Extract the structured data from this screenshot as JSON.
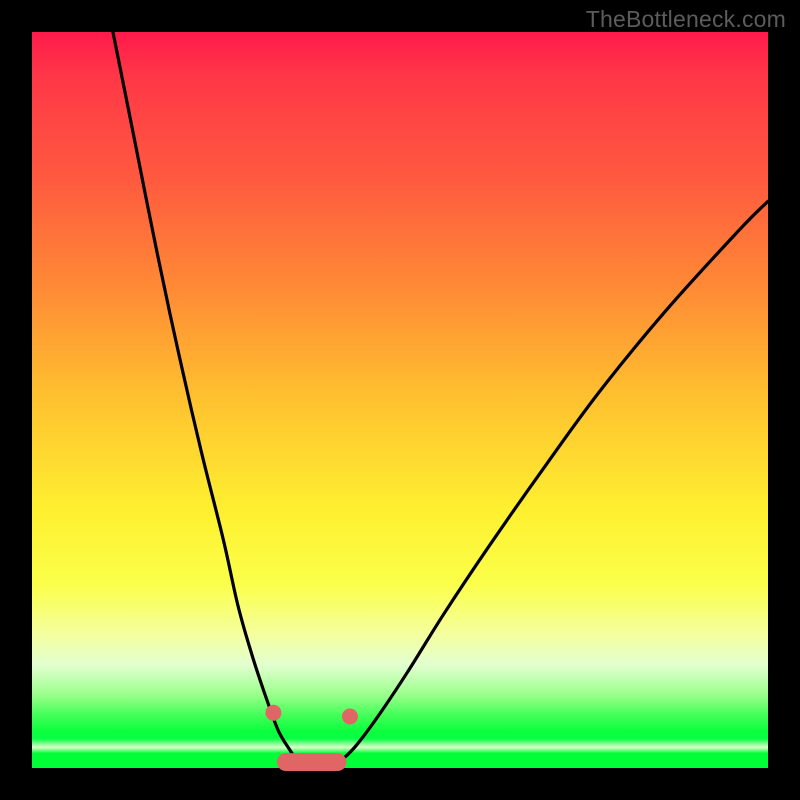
{
  "watermark": "TheBottleneck.com",
  "colors": {
    "frame": "#000000",
    "curve": "#000000",
    "marker_stroke": "#e06666",
    "marker_fill": "#e06666"
  },
  "chart_data": {
    "type": "line",
    "title": "",
    "xlabel": "",
    "ylabel": "",
    "xlim": [
      0,
      100
    ],
    "ylim": [
      0,
      100
    ],
    "grid": false,
    "legend": false,
    "description": "Bottleneck-style V-curve: two black curves descending from top, meeting near bottom at a flat minimum; pink rounded segment and two pink dots mark the minimum region.",
    "series": [
      {
        "name": "left-branch",
        "x": [
          11,
          14,
          17,
          20,
          23,
          26,
          28,
          30,
          32,
          33.5,
          35,
          36
        ],
        "y": [
          100,
          85,
          70,
          56,
          43,
          31,
          22,
          15,
          9,
          5,
          2.5,
          1
        ]
      },
      {
        "name": "right-branch",
        "x": [
          42,
          44,
          47,
          51,
          56,
          62,
          69,
          77,
          86,
          96,
          100
        ],
        "y": [
          1,
          3,
          7,
          13,
          21,
          30,
          40,
          51,
          62,
          73,
          77
        ]
      },
      {
        "name": "floor-segment",
        "x": [
          34.5,
          41.5
        ],
        "y": [
          0.8,
          0.8
        ]
      }
    ],
    "markers": [
      {
        "name": "left-dot",
        "x": 32.8,
        "y": 7.5
      },
      {
        "name": "right-dot",
        "x": 43.2,
        "y": 7.0
      }
    ]
  }
}
